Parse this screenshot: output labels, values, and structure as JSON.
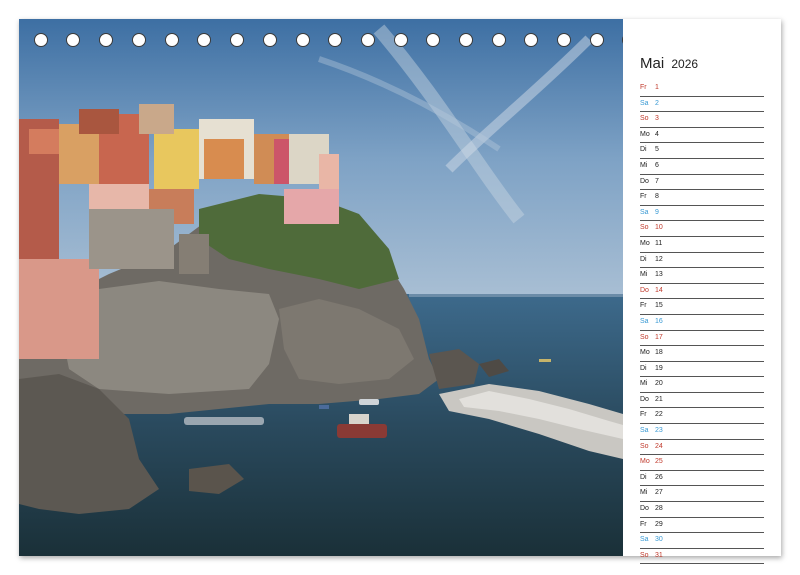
{
  "calendar": {
    "month": "Mai",
    "year": "2026",
    "days": [
      {
        "wd": "Fr",
        "d": "1",
        "t": "hol"
      },
      {
        "wd": "Sa",
        "d": "2",
        "t": "sat"
      },
      {
        "wd": "So",
        "d": "3",
        "t": "sun"
      },
      {
        "wd": "Mo",
        "d": "4",
        "t": "reg"
      },
      {
        "wd": "Di",
        "d": "5",
        "t": "reg"
      },
      {
        "wd": "Mi",
        "d": "6",
        "t": "reg"
      },
      {
        "wd": "Do",
        "d": "7",
        "t": "reg"
      },
      {
        "wd": "Fr",
        "d": "8",
        "t": "reg"
      },
      {
        "wd": "Sa",
        "d": "9",
        "t": "sat"
      },
      {
        "wd": "So",
        "d": "10",
        "t": "sun"
      },
      {
        "wd": "Mo",
        "d": "11",
        "t": "reg"
      },
      {
        "wd": "Di",
        "d": "12",
        "t": "reg"
      },
      {
        "wd": "Mi",
        "d": "13",
        "t": "reg"
      },
      {
        "wd": "Do",
        "d": "14",
        "t": "hol"
      },
      {
        "wd": "Fr",
        "d": "15",
        "t": "reg"
      },
      {
        "wd": "Sa",
        "d": "16",
        "t": "sat"
      },
      {
        "wd": "So",
        "d": "17",
        "t": "sun"
      },
      {
        "wd": "Mo",
        "d": "18",
        "t": "reg"
      },
      {
        "wd": "Di",
        "d": "19",
        "t": "reg"
      },
      {
        "wd": "Mi",
        "d": "20",
        "t": "reg"
      },
      {
        "wd": "Do",
        "d": "21",
        "t": "reg"
      },
      {
        "wd": "Fr",
        "d": "22",
        "t": "reg"
      },
      {
        "wd": "Sa",
        "d": "23",
        "t": "sat"
      },
      {
        "wd": "So",
        "d": "24",
        "t": "sun"
      },
      {
        "wd": "Mo",
        "d": "25",
        "t": "hol"
      },
      {
        "wd": "Di",
        "d": "26",
        "t": "reg"
      },
      {
        "wd": "Mi",
        "d": "27",
        "t": "reg"
      },
      {
        "wd": "Do",
        "d": "28",
        "t": "reg"
      },
      {
        "wd": "Fr",
        "d": "29",
        "t": "reg"
      },
      {
        "wd": "Sa",
        "d": "30",
        "t": "sat"
      },
      {
        "wd": "So",
        "d": "31",
        "t": "sun"
      }
    ]
  },
  "colors": {
    "saturday": "#3a9ad4",
    "sunday_holiday": "#c0392b",
    "weekday": "#222222",
    "ring": "#3a3a3a"
  }
}
